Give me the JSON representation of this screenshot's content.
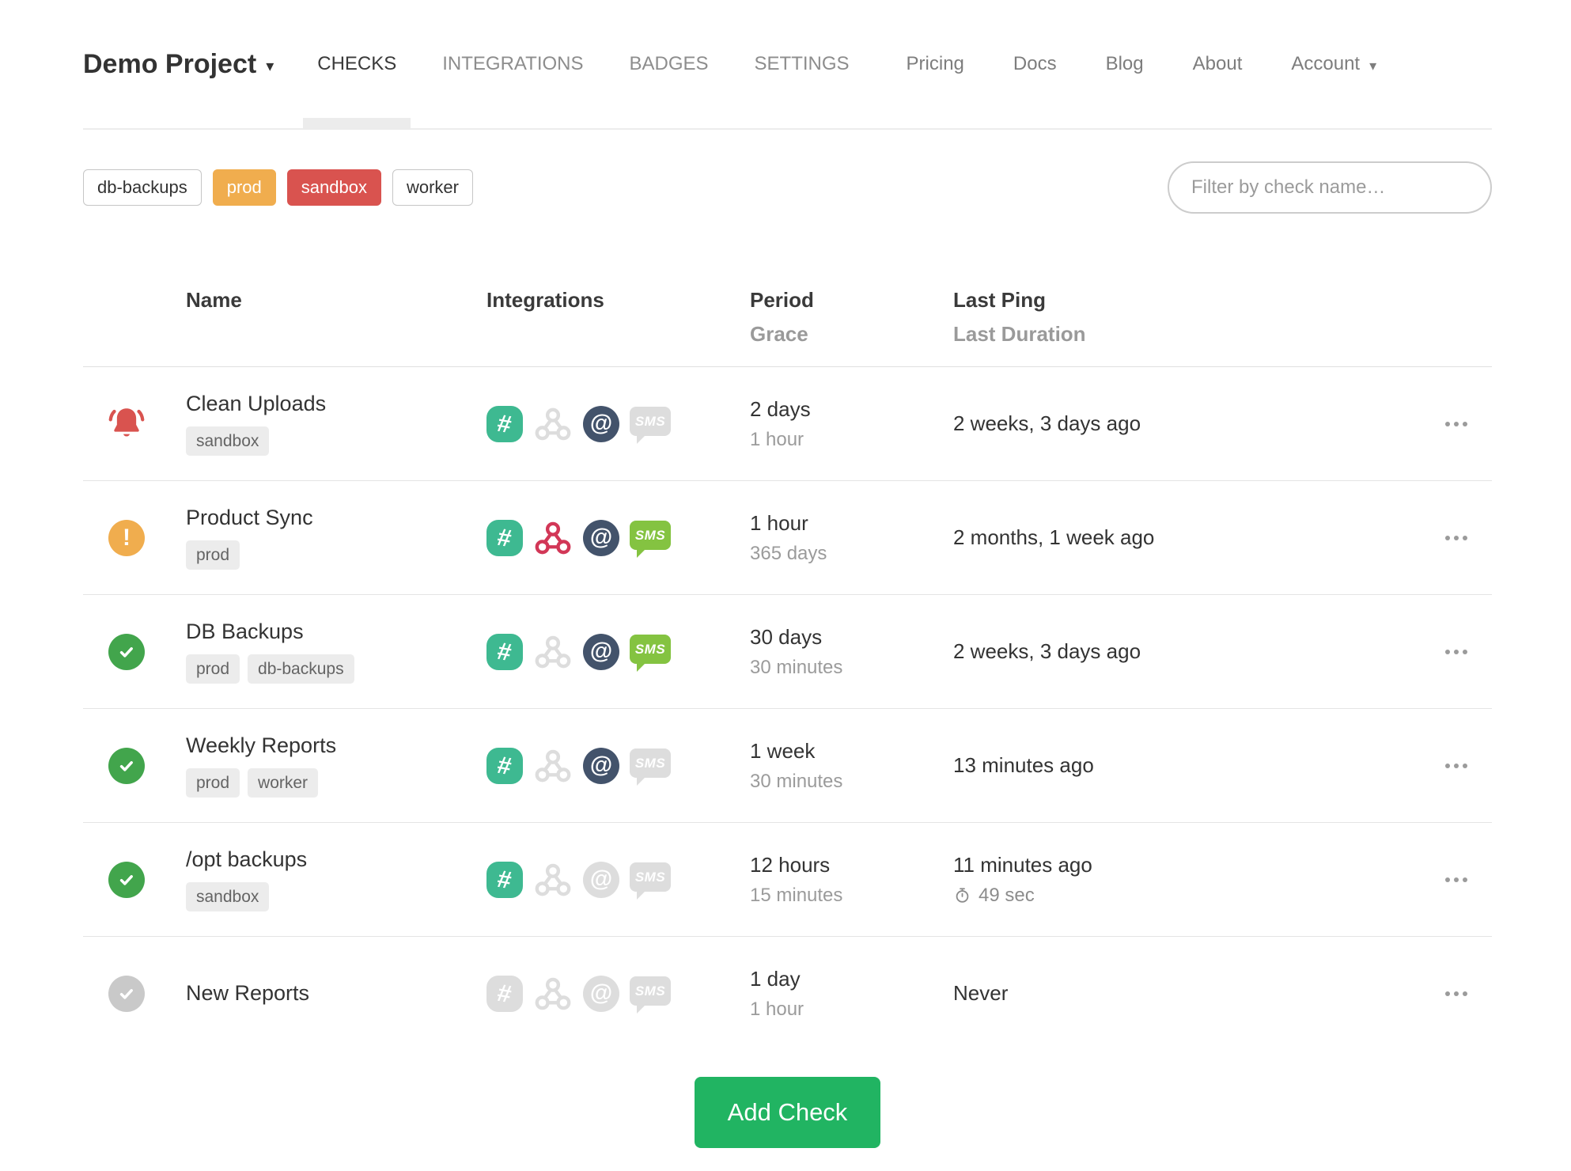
{
  "header": {
    "brand": {
      "label": "Demo Project"
    },
    "tabs": [
      {
        "label": "CHECKS",
        "active": true
      },
      {
        "label": "INTEGRATIONS",
        "active": false
      },
      {
        "label": "BADGES",
        "active": false
      },
      {
        "label": "SETTINGS",
        "active": false
      }
    ],
    "links": [
      {
        "label": "Pricing"
      },
      {
        "label": "Docs"
      },
      {
        "label": "Blog"
      },
      {
        "label": "About"
      }
    ],
    "account": {
      "label": "Account"
    }
  },
  "filter_bar": {
    "tags": [
      {
        "label": "db-backups",
        "variant": "outline"
      },
      {
        "label": "prod",
        "variant": "orange"
      },
      {
        "label": "sandbox",
        "variant": "red"
      },
      {
        "label": "worker",
        "variant": "outline"
      }
    ],
    "search_placeholder": "Filter by check name…"
  },
  "table": {
    "headers": {
      "name": "Name",
      "integrations": "Integrations",
      "period": "Period",
      "grace": "Grace",
      "last_ping": "Last Ping",
      "last_duration": "Last Duration"
    },
    "integration_kinds": [
      "slack",
      "webhook",
      "email",
      "sms"
    ],
    "rows": [
      {
        "status": "alert",
        "name": "Clean Uploads",
        "tags": [
          "sandbox"
        ],
        "integrations": {
          "slack": true,
          "webhook": false,
          "email": true,
          "sms": false
        },
        "period": "2 days",
        "grace": "1 hour",
        "last_ping": "2 weeks, 3 days ago",
        "last_duration": ""
      },
      {
        "status": "grace",
        "name": "Product Sync",
        "tags": [
          "prod"
        ],
        "integrations": {
          "slack": true,
          "webhook": true,
          "email": true,
          "sms": true
        },
        "period": "1 hour",
        "grace": "365 days",
        "last_ping": "2 months, 1 week ago",
        "last_duration": ""
      },
      {
        "status": "up",
        "name": "DB Backups",
        "tags": [
          "prod",
          "db-backups"
        ],
        "integrations": {
          "slack": true,
          "webhook": false,
          "email": true,
          "sms": true
        },
        "period": "30 days",
        "grace": "30 minutes",
        "last_ping": "2 weeks, 3 days ago",
        "last_duration": ""
      },
      {
        "status": "up",
        "name": "Weekly Reports",
        "tags": [
          "prod",
          "worker"
        ],
        "integrations": {
          "slack": true,
          "webhook": false,
          "email": true,
          "sms": false
        },
        "period": "1 week",
        "grace": "30 minutes",
        "last_ping": "13 minutes ago",
        "last_duration": ""
      },
      {
        "status": "up",
        "name": "/opt backups",
        "tags": [
          "sandbox"
        ],
        "integrations": {
          "slack": true,
          "webhook": false,
          "email": false,
          "sms": false
        },
        "period": "12 hours",
        "grace": "15 minutes",
        "last_ping": "11 minutes ago",
        "last_duration": "49 sec"
      },
      {
        "status": "new",
        "name": "New Reports",
        "tags": [],
        "integrations": {
          "slack": false,
          "webhook": false,
          "email": false,
          "sms": false
        },
        "period": "1 day",
        "grace": "1 hour",
        "last_ping": "Never",
        "last_duration": ""
      }
    ]
  },
  "add_check": {
    "label": "Add Check"
  },
  "colors": {
    "alert_red": "#d9534f",
    "grace_orange": "#f0ad4e",
    "up_green": "#42a54c",
    "new_gray": "#c9c9c9",
    "slack_green": "#3eb991",
    "webhook_crimson": "#d23757",
    "email_navy": "#43536b",
    "sms_green": "#84c341",
    "inactive_gray": "#dddddd",
    "add_check_green": "#21b462"
  }
}
